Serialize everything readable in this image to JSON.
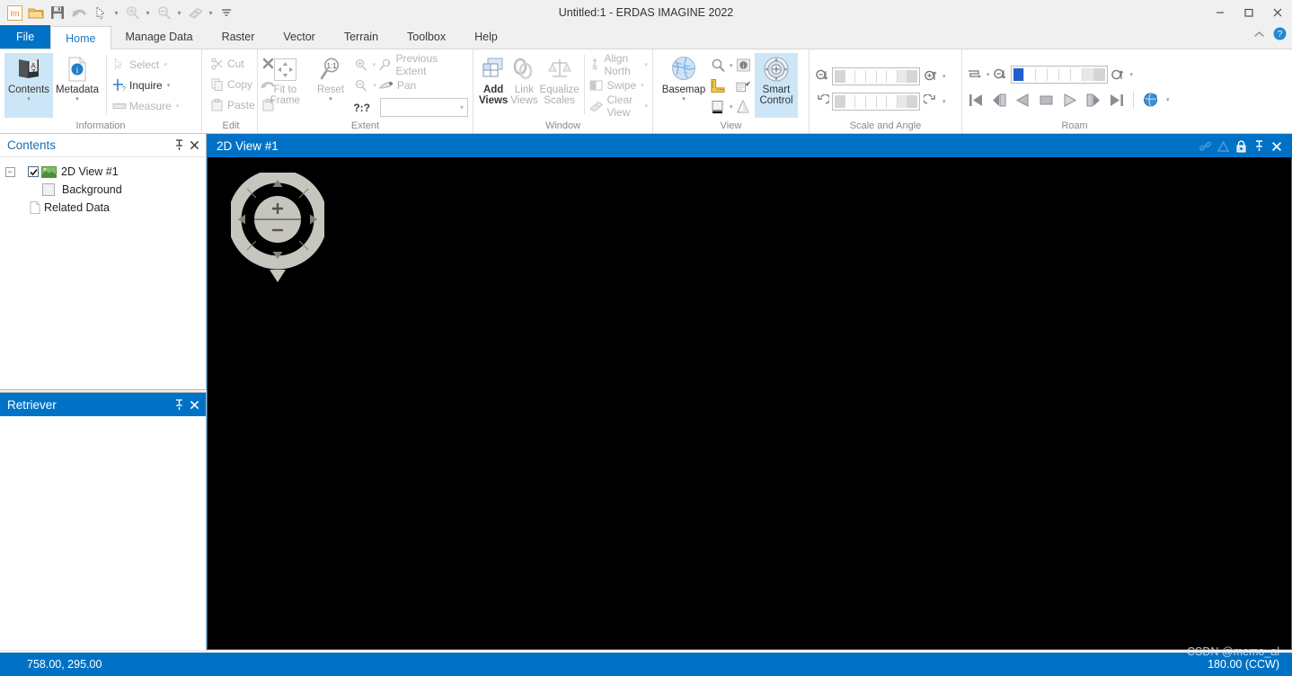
{
  "window": {
    "title": "Untitled:1 -  ERDAS IMAGINE 2022",
    "minimize": "minimize-icon",
    "maximize": "maximize-icon",
    "close": "close-icon"
  },
  "quick_access": [
    {
      "name": "app-logo-icon",
      "glyph": "Im"
    },
    {
      "name": "open-folder-icon",
      "glyph": "folder"
    },
    {
      "name": "save-icon",
      "glyph": "save"
    },
    {
      "name": "undo-icon",
      "glyph": "undo"
    },
    {
      "name": "select-cursor-icon",
      "glyph": "cursor"
    },
    {
      "name": "zoom-in-icon",
      "glyph": "zoom-in"
    },
    {
      "name": "zoom-out-icon",
      "glyph": "zoom-out"
    },
    {
      "name": "clear-view-icon",
      "glyph": "eraser"
    },
    {
      "name": "customize-qat-icon",
      "glyph": "more"
    }
  ],
  "tabs": [
    {
      "label": "File",
      "kind": "file"
    },
    {
      "label": "Home",
      "kind": "active"
    },
    {
      "label": "Manage Data",
      "kind": "normal"
    },
    {
      "label": "Raster",
      "kind": "normal"
    },
    {
      "label": "Vector",
      "kind": "normal"
    },
    {
      "label": "Terrain",
      "kind": "normal"
    },
    {
      "label": "Toolbox",
      "kind": "normal"
    },
    {
      "label": "Help",
      "kind": "normal"
    }
  ],
  "tab_right": [
    {
      "name": "collapse-ribbon-icon"
    },
    {
      "name": "help-icon"
    }
  ],
  "ribbon": {
    "groups": [
      {
        "name": "information",
        "label": "Information",
        "big": [
          {
            "label": "Contents",
            "icon": "az-book-icon",
            "selected": true,
            "dropdown": true
          },
          {
            "label": "Metadata",
            "icon": "metadata-info-icon",
            "selected": false,
            "dropdown": true
          }
        ],
        "small": [
          {
            "label": "Select",
            "icon": "select-arrow-icon",
            "disabled": true,
            "dropdown": true
          },
          {
            "label": "Inquire",
            "icon": "inquire-crosshair-icon",
            "disabled": false,
            "dropdown": true
          },
          {
            "label": "Measure",
            "icon": "measure-ruler-icon",
            "disabled": true,
            "dropdown": true
          }
        ]
      },
      {
        "name": "edit",
        "label": "Edit",
        "small": [
          {
            "label": "Cut",
            "icon": "scissors-icon",
            "disabled": true
          },
          {
            "label": "Copy",
            "icon": "copy-icon",
            "disabled": true
          },
          {
            "label": "Paste",
            "icon": "paste-icon",
            "disabled": true
          }
        ],
        "small2": [
          {
            "label": "",
            "icon": "delete-x-icon",
            "disabled": true
          },
          {
            "label": "",
            "icon": "undo-arc-icon",
            "disabled": true
          },
          {
            "label": "",
            "icon": "clipboard-icon",
            "disabled": true
          }
        ]
      },
      {
        "name": "extent",
        "label": "Extent",
        "dialog_launcher": true,
        "big": [
          {
            "label": "Fit to Frame",
            "icon": "fit-to-frame-icon",
            "disabled": true,
            "dropdown": false
          },
          {
            "label": "Reset",
            "icon": "reset-1to1-icon",
            "disabled": true,
            "dropdown": true
          }
        ],
        "small": [
          {
            "label": "Previous Extent",
            "icon": "previous-extent-icon",
            "disabled": true,
            "pre_icon": "zoom-in-small-icon",
            "dropdown": true
          },
          {
            "label": "Pan",
            "icon": "pan-hand-icon",
            "disabled": true,
            "pre_icon": "zoom-out-small-icon",
            "dropdown": true
          }
        ],
        "unknown_label": "?:?",
        "combo_value": "",
        "combo_placeholder": ""
      },
      {
        "name": "window",
        "label": "Window",
        "big": [
          {
            "label": "Add Views",
            "icon": "add-views-icon",
            "disabled": false,
            "dropdown": true
          },
          {
            "label": "Link Views",
            "icon": "link-views-icon",
            "disabled": true,
            "dropdown": true
          },
          {
            "label": "Equalize Scales",
            "icon": "equalize-scales-icon",
            "disabled": true,
            "dropdown": false
          }
        ],
        "small": [
          {
            "label": "Align North",
            "icon": "align-north-icon",
            "disabled": true,
            "dropdown": true
          },
          {
            "label": "Swipe",
            "icon": "swipe-icon",
            "disabled": true,
            "dropdown": true
          },
          {
            "label": "Clear View",
            "icon": "clear-view-eraser-icon",
            "disabled": true,
            "dropdown": true
          }
        ]
      },
      {
        "name": "view",
        "label": "View",
        "dialog_launcher": true,
        "big": [
          {
            "label": "Basemap",
            "icon": "basemap-globe-icon",
            "disabled": false,
            "dropdown": true
          },
          {
            "label": "Smart Control",
            "icon": "smart-control-icon",
            "selected": true,
            "dropdown": false
          }
        ],
        "icon_grid": [
          {
            "name": "magnifier-icon",
            "dropdown": true
          },
          {
            "name": "image-info-icon",
            "dropdown": false
          },
          {
            "name": "scale-ruler-icon",
            "dropdown": false
          },
          {
            "name": "view-properties-icon",
            "dropdown": false
          },
          {
            "name": "background-color-icon",
            "dropdown": true
          },
          {
            "name": "contrast-cone-icon",
            "dropdown": false
          }
        ]
      },
      {
        "name": "scale-and-angle",
        "label": "Scale and Angle",
        "rows": [
          {
            "left_icon": "zoom-out-step-icon",
            "slider_fill": 0,
            "right_icon": "zoom-in-step-icon",
            "dropdown": true
          },
          {
            "left_icon": "rotate-ccw-icon",
            "slider_fill": 0,
            "right_icon": "rotate-cw-icon",
            "dropdown": true
          }
        ]
      },
      {
        "name": "roam",
        "label": "Roam",
        "dialog_launcher": true,
        "top_row": [
          {
            "name": "roam-path-icon",
            "dropdown": true
          },
          {
            "name": "roam-speed-down-icon",
            "dropdown": false
          }
        ],
        "slider_fill_pct": 22,
        "top_row_right": [
          {
            "name": "roam-speed-up-icon",
            "dropdown": true
          }
        ],
        "transport": [
          {
            "name": "skip-start-icon"
          },
          {
            "name": "step-back-icon"
          },
          {
            "name": "play-back-icon"
          },
          {
            "name": "stop-icon"
          },
          {
            "name": "play-forward-icon"
          },
          {
            "name": "step-forward-icon"
          },
          {
            "name": "skip-end-icon"
          },
          {
            "name": "roam-globe-icon",
            "dropdown": true
          }
        ]
      }
    ]
  },
  "contents_panel": {
    "title": "Contents",
    "pin_icon": "pin-icon",
    "close_icon": "close-icon",
    "tree": [
      {
        "label": "2D View #1",
        "icon": "view-thumbnail-icon",
        "checked": true,
        "expander": "-",
        "indent": 0
      },
      {
        "label": "Background",
        "icon": "background-square-icon",
        "checked": false,
        "indent": 1
      },
      {
        "label": "Related Data",
        "icon": "document-icon",
        "indent": 0
      }
    ]
  },
  "retriever_panel": {
    "title": "Retriever",
    "pin_icon": "pin-icon",
    "close_icon": "close-icon"
  },
  "view_window": {
    "title": "2D View #1",
    "icons": [
      {
        "name": "link-chain-icon"
      },
      {
        "name": "triangle-icon"
      },
      {
        "name": "lock-icon"
      },
      {
        "name": "pin-icon"
      },
      {
        "name": "close-icon"
      }
    ],
    "nav_control": {
      "name": "smart-navigation-control",
      "zoom_in": "+",
      "zoom_out": "−"
    }
  },
  "statusbar": {
    "coordinates": "758.00, 295.00",
    "angle": "180.00 (CCW)",
    "watermark": "CSDN @memo_al"
  },
  "colors": {
    "accent_blue": "#0072c6",
    "ribbon_selected": "#cde6f7",
    "canvas": "#000000",
    "disabled_text": "#b5b5b5"
  }
}
